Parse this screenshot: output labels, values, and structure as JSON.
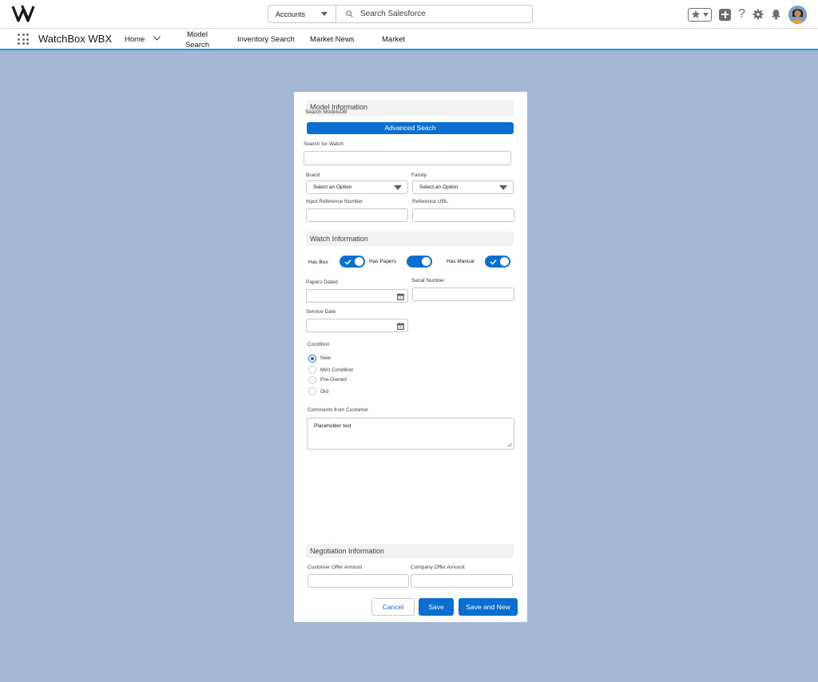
{
  "header": {
    "search_scope": "Accounts",
    "search_placeholder": "Search Salesforce",
    "icons": [
      "favorites-star-icon",
      "add-icon",
      "help-icon",
      "setup-gear-icon",
      "notification-bell-icon",
      "avatar"
    ]
  },
  "nav": {
    "app_name": "WatchBox WBX",
    "items": [
      {
        "label": "Home"
      },
      {
        "label": "Model Search"
      },
      {
        "label": "Inventory Search"
      },
      {
        "label": "Market News"
      },
      {
        "label": "Market"
      }
    ]
  },
  "form": {
    "model_section": {
      "title": "Model Information",
      "search_modeldb_label": "Search ModelsDB",
      "advanced_search_label": "Advanced Seach",
      "search_watch_label": "Search for Watch",
      "brand_label": "Brand",
      "brand_value": "Select an Option",
      "family_label": "Family",
      "family_value": "Select an Option",
      "ref_number_label": "Input Reference Number",
      "ref_url_label": "Reference URL"
    },
    "watch_section": {
      "title": "Watch Information",
      "has_box_label": "Has Box",
      "has_papers_label": "Has Papers",
      "has_manual_label": "Has Manual",
      "papers_dated_label": "Papers Dated",
      "serial_number_label": "Serial Number",
      "service_date_label": "Service Date",
      "condition_label": "Condition",
      "condition_options": [
        "New",
        "Mint Condition",
        "Pre-Owned",
        "Old"
      ],
      "condition_selected": "New",
      "comments_label": "Comments from Customer",
      "comments_placeholder": "Placeholder text"
    },
    "negotiation_section": {
      "title": "Negotiation Information",
      "customer_offer_label": "Customer Offer Amount",
      "company_offer_label": "Company Offer Amount"
    },
    "actions": {
      "cancel": "Cancel",
      "save": "Save",
      "save_and_new": "Save and New"
    }
  },
  "colors": {
    "brand": "#0b6fd0",
    "background": "#a4b7d4",
    "nav_underline": "#1b96ff"
  }
}
